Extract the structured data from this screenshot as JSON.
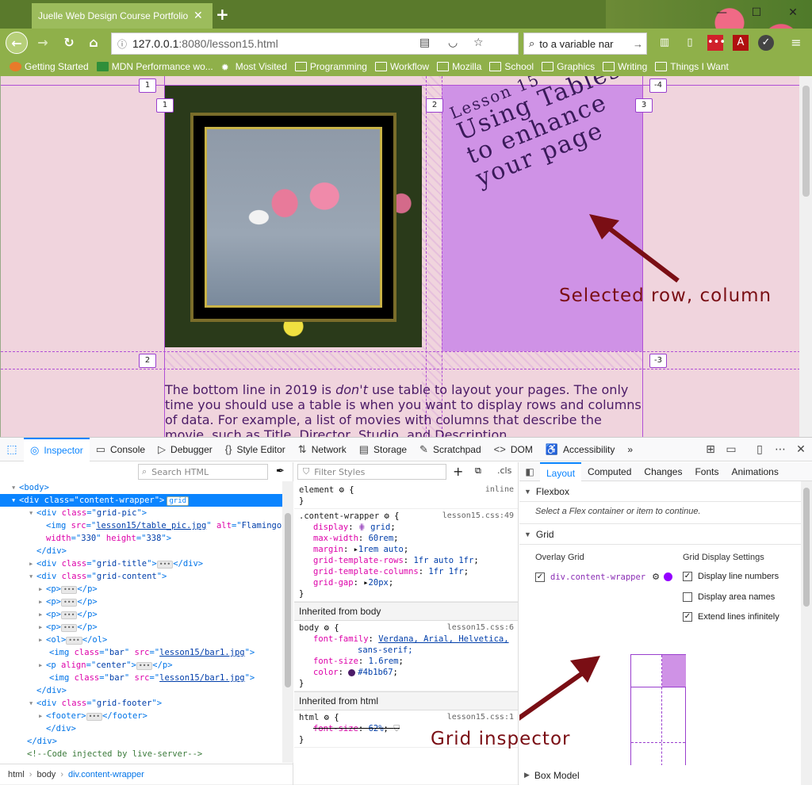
{
  "browser": {
    "tab_title": "Juelle Web Design Course Portfolio",
    "tab_close": "✕",
    "new_tab": "+",
    "url_host": "127.0.0.1",
    "url_path": ":8080/lesson15.html",
    "search_text": "to a variable nar",
    "bookmarks": [
      "Getting Started",
      "MDN Performance wo...",
      "Most Visited",
      "Programming",
      "Workflow",
      "Mozilla",
      "School",
      "Graphics",
      "Writing",
      "Things I Want"
    ]
  },
  "page": {
    "title_line1": "Lesson 15",
    "title_line2": "Using Tables",
    "title_line3": "to enhance",
    "title_line4": "your page",
    "body_pre": "The bottom line in 2019 is ",
    "body_em": "don't",
    "body_post": " use table to layout your pages. The only time you should use a table is when you want to display rows and columns of data. For example, a list of movies with columns that describe the movie, such as Title, Director, Studio, and Description.",
    "img_alt": "Flamingos",
    "grid_badges": {
      "top1": "1",
      "left1": "1",
      "col2": "2",
      "col3": "3",
      "topneg4": "-4",
      "row2": "2",
      "rowneg3": "-3"
    },
    "text_color": "#4b1b67",
    "grid_highlight": "#cf92e6"
  },
  "annotations": {
    "selected": "Selected row, column",
    "grid_inspector": "Grid inspector"
  },
  "devtools": {
    "tabs": [
      "Inspector",
      "Console",
      "Debugger",
      "Style Editor",
      "Network",
      "Storage",
      "Scratchpad",
      "DOM",
      "Accessibility"
    ],
    "search_html_placeholder": "Search HTML",
    "filter_styles_placeholder": "Filter Styles",
    "cls_label": ".cls",
    "breadcrumbs": [
      "html",
      "body",
      "div.content-wrapper"
    ],
    "markup": {
      "body": "<body>",
      "cw_tag": "div",
      "cw_class": "content-wrapper",
      "grid_badge": "grid",
      "gridpic_class": "grid-pic",
      "img_src": "lesson15/table_pic.jpg",
      "img_alt": "Flamingos",
      "img_width": "330",
      "img_height": "338",
      "gridtitle_class": "grid-title",
      "gridcontent_class": "grid-content",
      "bar_class": "bar",
      "bar_src": "lesson15/bar1.jpg",
      "p_align": "center",
      "gridfooter_class": "grid-footer",
      "comment": "<!--Code injected by live-server-->"
    },
    "rules": {
      "element": "element",
      "element_src": "inline",
      "cw_selector": ".content-wrapper",
      "cw_src": "lesson15.css:49",
      "cw_decls": [
        [
          "display",
          "grid"
        ],
        [
          "max-width",
          "60rem"
        ],
        [
          "margin",
          "1rem auto"
        ],
        [
          "grid-template-rows",
          "1fr auto 1fr"
        ],
        [
          "grid-template-columns",
          "1fr 1fr"
        ],
        [
          "grid-gap",
          "20px"
        ]
      ],
      "inherited_body": "Inherited from body",
      "body_selector": "body",
      "body_src": "lesson15.css:6",
      "body_font_family_1": "Verdana, Arial, Helvetica,",
      "body_font_family_2": "sans-serif;",
      "body_font_size": "1.6rem",
      "body_color": "#4b1b67",
      "inherited_html": "Inherited from html",
      "html_selector": "html",
      "html_src": "lesson15.css:1",
      "html_font_size": "62%"
    },
    "layout": {
      "tabs": [
        "Layout",
        "Computed",
        "Changes",
        "Fonts",
        "Animations"
      ],
      "flexbox": "Flexbox",
      "flex_hint": "Select a Flex container or item to continue.",
      "grid": "Grid",
      "overlay_grid": "Overlay Grid",
      "overlay_item": "div.content-wrapper",
      "display_settings": "Grid Display Settings",
      "line_numbers": "Display line numbers",
      "area_names": "Display area names",
      "extend_lines": "Extend lines infinitely",
      "box_model": "Box Model",
      "overlay_color": "#9400ff"
    }
  }
}
